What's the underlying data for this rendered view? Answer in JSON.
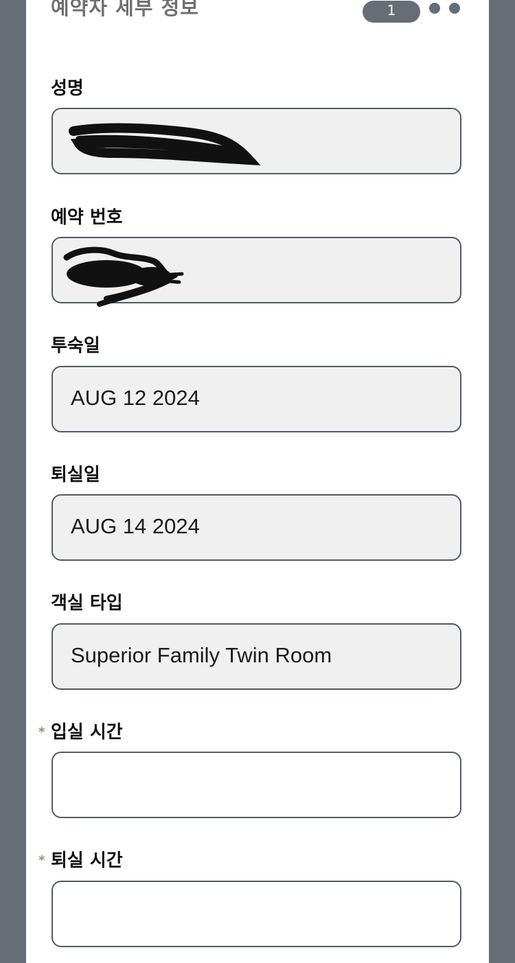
{
  "header": {
    "title": "예약자 세부 정보",
    "step_current": "1"
  },
  "fields": {
    "name": {
      "label": "성명",
      "value": ""
    },
    "booking_number": {
      "label": "예약 번호",
      "value": ""
    },
    "check_in_date": {
      "label": "투숙일",
      "value": "AUG 12 2024"
    },
    "check_out_date": {
      "label": "퇴실일",
      "value": "AUG 14 2024"
    },
    "room_type": {
      "label": "객실 타입",
      "value": "Superior Family Twin Room"
    },
    "check_in_time": {
      "label": "입실 시간",
      "required_mark": "*",
      "value": ""
    },
    "check_out_time": {
      "label": "퇴실 시간",
      "required_mark": "*",
      "value": ""
    }
  },
  "colors": {
    "side_background": "#676d75",
    "readonly_field_background": "#f0f0f0",
    "required_star": "#a08a5a"
  }
}
